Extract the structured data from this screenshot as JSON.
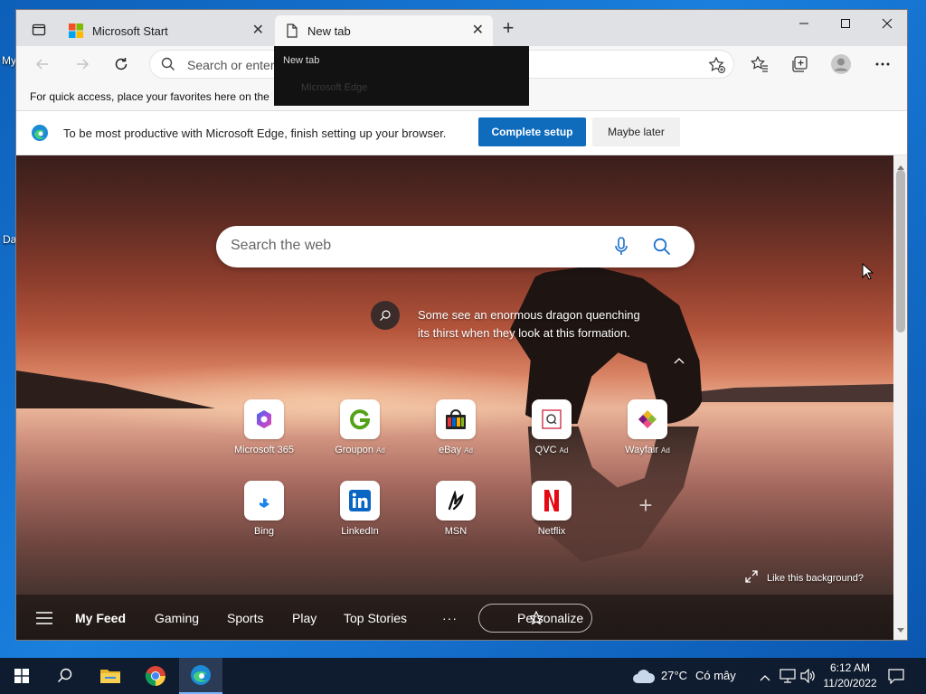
{
  "desktop": {
    "labels": [
      "My",
      "Da"
    ]
  },
  "browser": {
    "tabs": [
      {
        "title": "Microsoft Start",
        "active": false
      },
      {
        "title": "New tab",
        "active": true
      }
    ],
    "new_tab_symbol": "+",
    "address_placeholder": "Search or enter",
    "favorites_hint": "For quick access, place your favorites here on the",
    "dropdown": {
      "line1": "New tab",
      "line2": "Microsoft Edge"
    }
  },
  "setup_bar": {
    "message": "To be most productive with Microsoft Edge, finish setting up your browser.",
    "primary_button": "Complete setup",
    "secondary_button": "Maybe later"
  },
  "newtab": {
    "search_placeholder": "Search the web",
    "caption": "Some see an enormous dragon quenching its thirst when they look at this formation.",
    "tiles": [
      {
        "label": "Microsoft 365",
        "ad": "",
        "icon": "microsoft-365-icon"
      },
      {
        "label": "Groupon",
        "ad": "Ad",
        "icon": "groupon-icon"
      },
      {
        "label": "eBay",
        "ad": "Ad",
        "icon": "ebay-icon"
      },
      {
        "label": "QVC",
        "ad": "Ad",
        "icon": "qvc-icon"
      },
      {
        "label": "Wayfair",
        "ad": "Ad",
        "icon": "wayfair-icon"
      },
      {
        "label": "Bing",
        "ad": "",
        "icon": "bing-icon"
      },
      {
        "label": "LinkedIn",
        "ad": "",
        "icon": "linkedin-icon"
      },
      {
        "label": "MSN",
        "ad": "",
        "icon": "msn-icon"
      },
      {
        "label": "Netflix",
        "ad": "",
        "icon": "netflix-icon"
      }
    ],
    "add_tile_symbol": "+",
    "like_background": "Like this background?",
    "feed": {
      "items": [
        "My Feed",
        "Gaming",
        "Sports",
        "Play",
        "Top Stories"
      ],
      "more": "···",
      "personalize": "Personalize"
    }
  },
  "taskbar": {
    "weather_temp": "27°C",
    "weather_text": "Có mây",
    "time": "6:12 AM",
    "date": "11/20/2022"
  },
  "colors": {
    "accent": "#0f6cbd",
    "taskbar": "#0f1b2e",
    "desktop": "#1572c8"
  }
}
